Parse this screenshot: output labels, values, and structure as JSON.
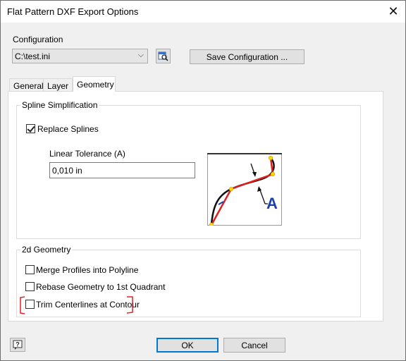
{
  "window": {
    "title": "Flat Pattern DXF Export Options",
    "close_glyph": "✕"
  },
  "configuration": {
    "label": "Configuration",
    "selected": "C:\\test.ini",
    "save_label": "Save Configuration ..."
  },
  "tabs": [
    {
      "label": "General",
      "active": false
    },
    {
      "label": "Layer",
      "active": false
    },
    {
      "label": "Geometry",
      "active": true
    }
  ],
  "spline": {
    "group_title": "Spline Simplification",
    "replace_label": "Replace Splines",
    "replace_checked": true,
    "tolerance_label": "Linear Tolerance (A)",
    "tolerance_value": "0,010 in",
    "diagram_label": "A"
  },
  "geometry2d": {
    "group_title": "2d Geometry",
    "options": [
      {
        "label": "Merge Profiles into Polyline",
        "checked": false
      },
      {
        "label": "Rebase Geometry to 1st Quadrant",
        "checked": false
      },
      {
        "label": "Trim Centerlines at Contour",
        "checked": false
      }
    ]
  },
  "footer": {
    "ok_label": "OK",
    "cancel_label": "Cancel",
    "help_icon": "help-icon"
  },
  "colors": {
    "accent": "#0078d7",
    "highlight_red": "#e02020",
    "diagram_blue": "#1a3fb0"
  }
}
